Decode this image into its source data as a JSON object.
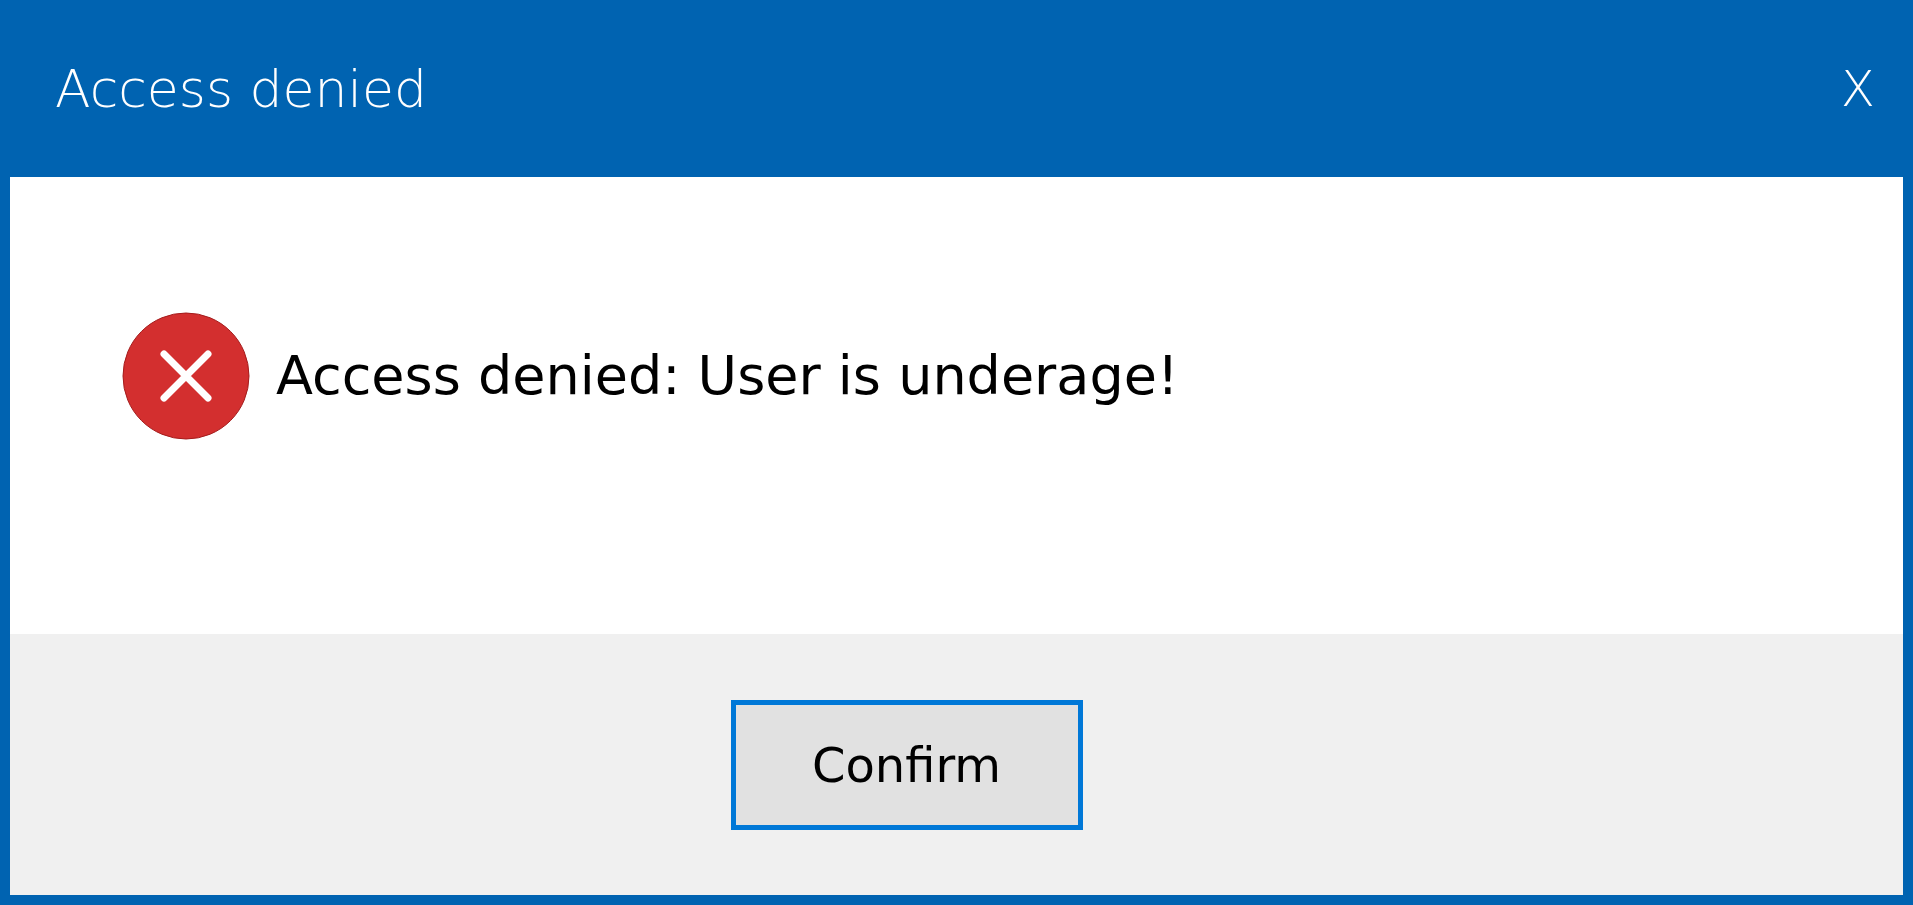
{
  "window": {
    "title": "Access denied",
    "close": "X"
  },
  "message": {
    "text": "Access denied: User is underage!"
  },
  "buttons": [
    {
      "label": "Confirm",
      "focused": true
    }
  ]
}
